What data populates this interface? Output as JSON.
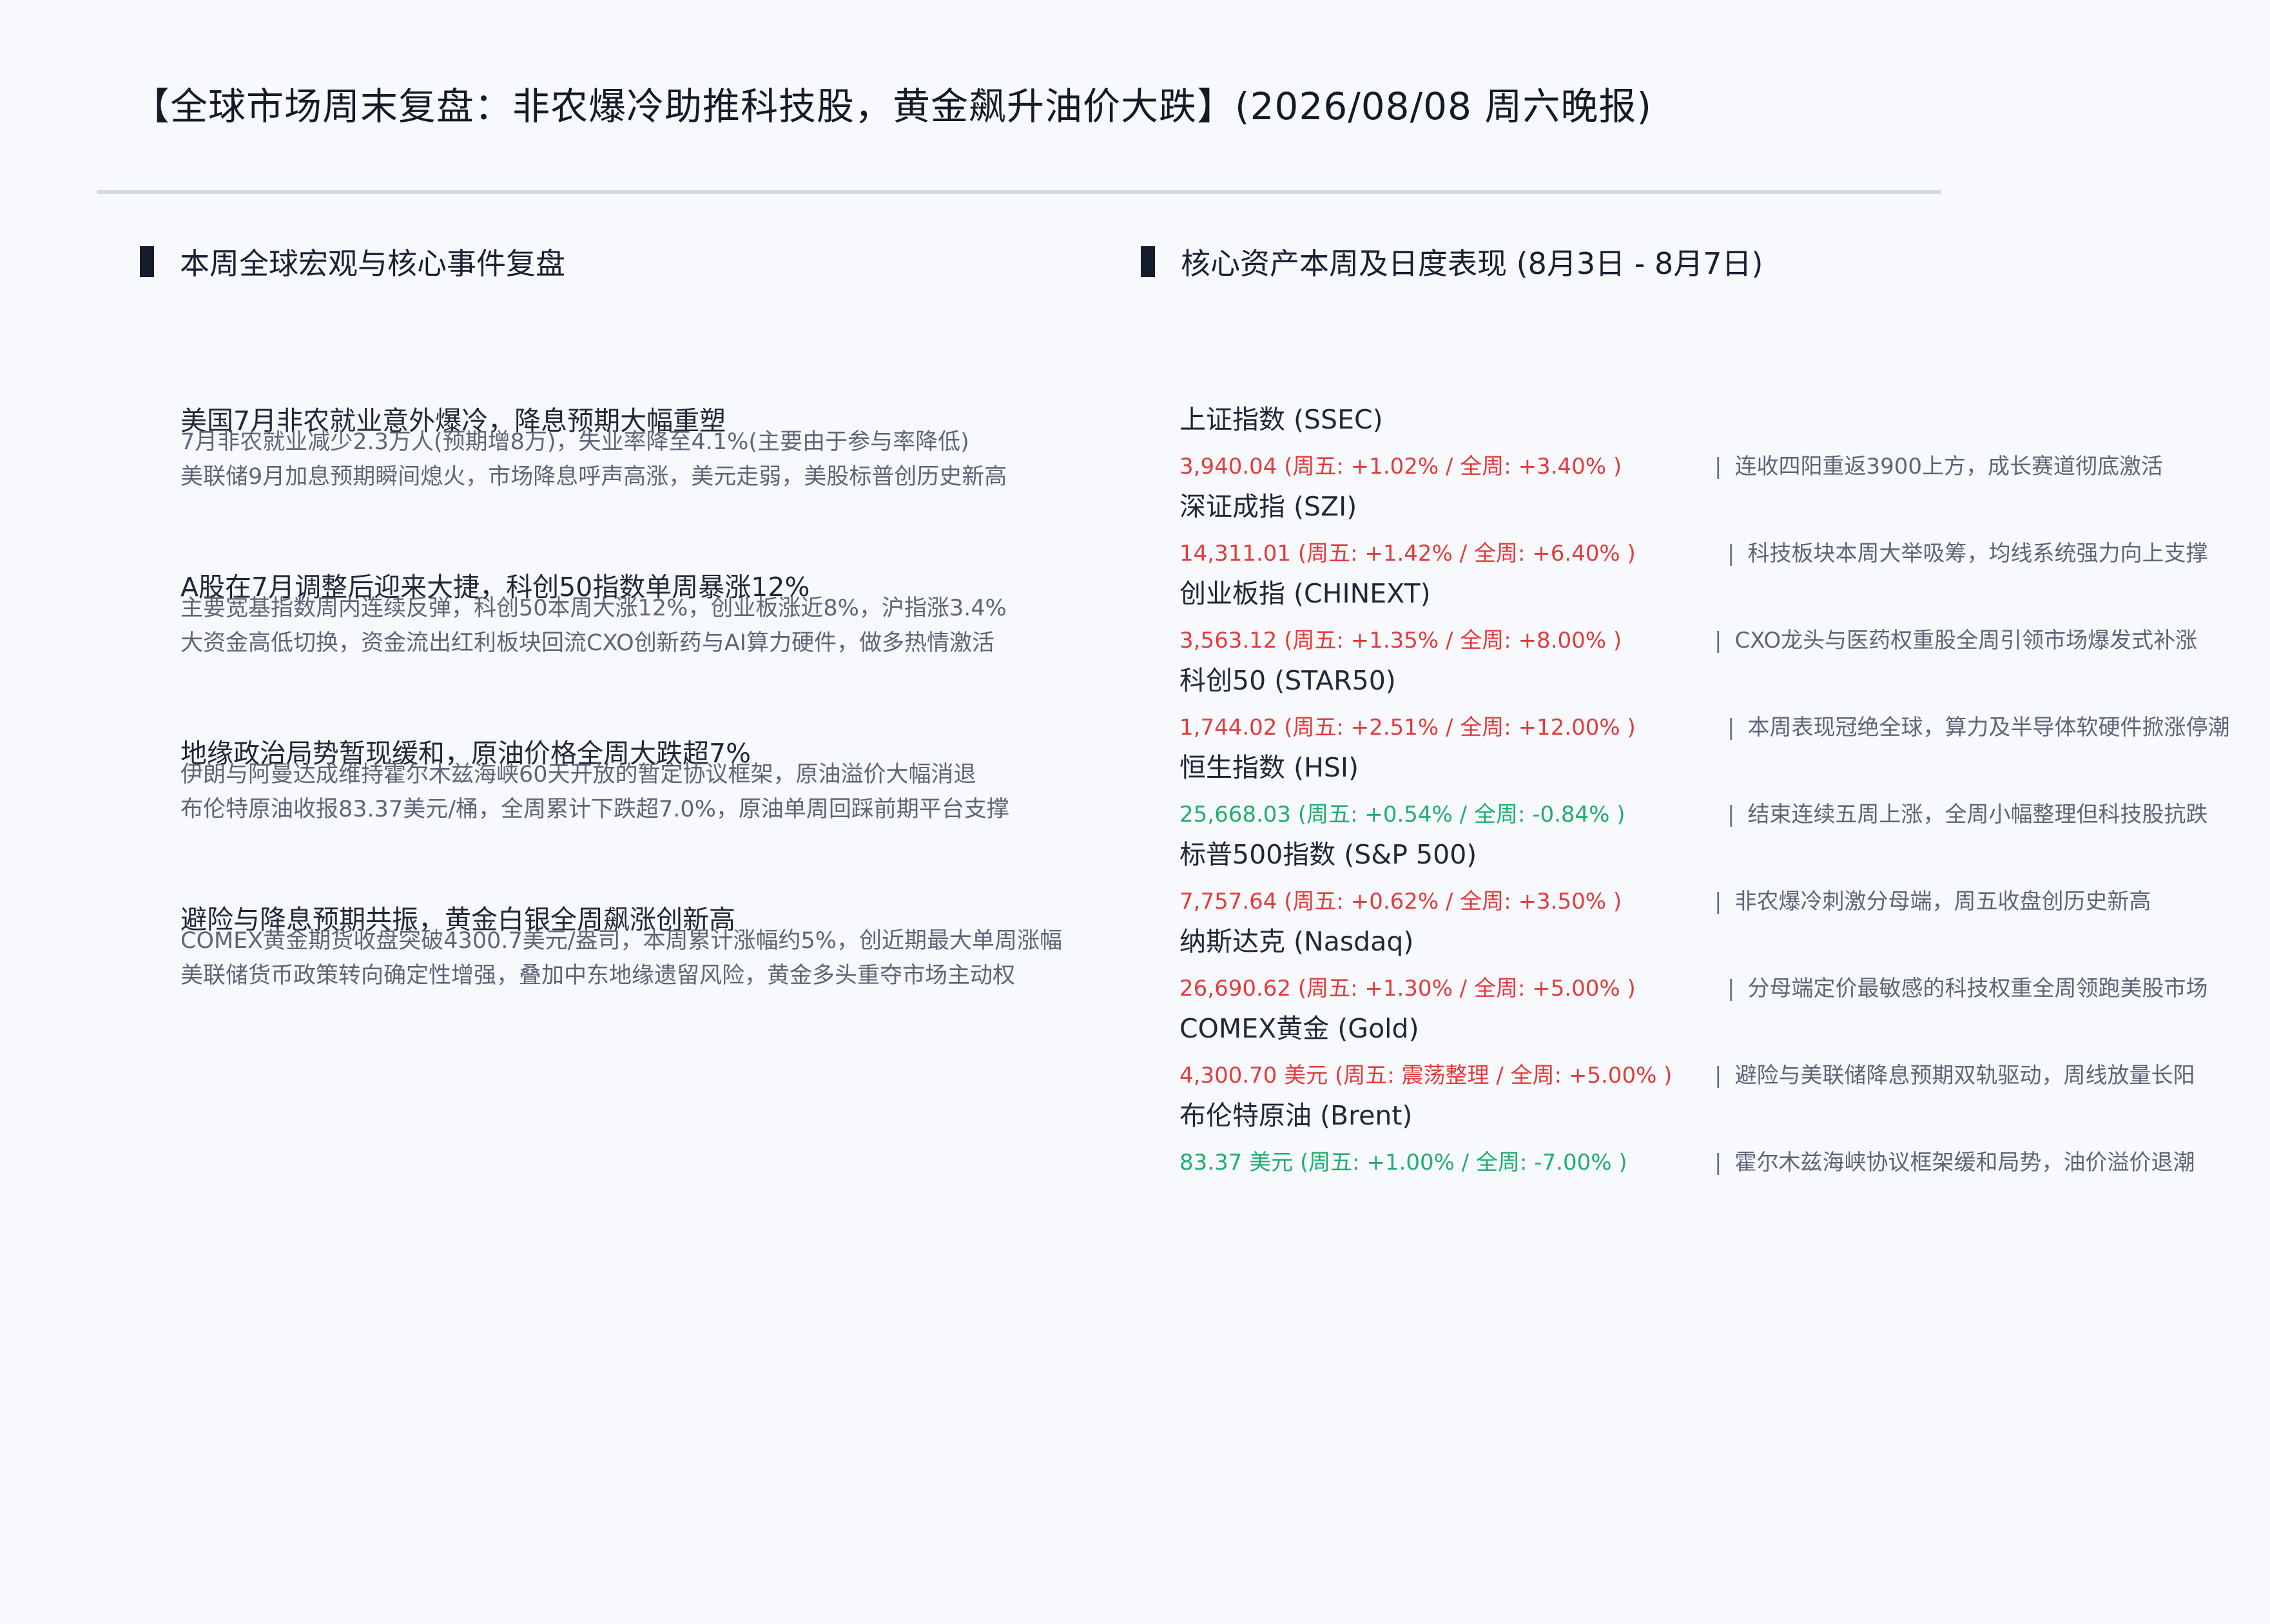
{
  "title": "【全球市场周末复盘：非农爆冷助推科技股，黄金飙升油价大跌】(2026/08/08 周六晚报)",
  "left_section": {
    "heading": "本周全球宏观与核心事件复盘",
    "events": [
      {
        "title": "美国7月非农就业意外爆冷，降息预期大幅重塑",
        "line1": "7月非农就业减少2.3万人(预期增8万)，失业率降至4.1%(主要由于参与率降低)",
        "line2": "美联储9月加息预期瞬间熄火，市场降息呼声高涨，美元走弱，美股标普创历史新高"
      },
      {
        "title": "A股在7月调整后迎来大捷，科创50指数单周暴涨12%",
        "line1": "主要宽基指数周内连续反弹，科创50本周大涨12%，创业板涨近8%，沪指涨3.4%",
        "line2": "大资金高低切换，资金流出红利板块回流CXO创新药与AI算力硬件，做多热情激活"
      },
      {
        "title": "地缘政治局势暂现缓和，原油价格全周大跌超7%",
        "line1": "伊朗与阿曼达成维持霍尔木兹海峡60天开放的暂定协议框架，原油溢价大幅消退",
        "line2": "布伦特原油收报83.37美元/桶，全周累计下跌超7.0%，原油单周回踩前期平台支撑"
      },
      {
        "title": "避险与降息预期共振，黄金白银全周飙涨创新高",
        "line1": "COMEX黄金期货收盘突破4300.7美元/盎司，本周累计涨幅约5%，创近期最大单周涨幅",
        "line2": "美联储货币政策转向确定性增强，叠加中东地缘遗留风险，黄金多头重夺市场主动权"
      }
    ]
  },
  "right_section": {
    "heading": "核心资产本周及日度表现 (8月3日 - 8月7日)",
    "assets": [
      {
        "name": "上证指数 (SSEC)",
        "values": "3,940.04 (周五: +1.02%  / 全周: +3.40% )",
        "note": "连收四阳重返3900上方，成长赛道彻底激活",
        "trend": "up"
      },
      {
        "name": "深证成指 (SZI)",
        "values": "14,311.01 (周五: +1.42%  / 全周: +6.40% )",
        "note": "科技板块本周大举吸筹，均线系统强力向上支撑",
        "trend": "up"
      },
      {
        "name": "创业板指 (CHINEXT)",
        "values": "3,563.12 (周五: +1.35%  / 全周: +8.00% )",
        "note": "CXO龙头与医药权重股全周引领市场爆发式补涨",
        "trend": "up"
      },
      {
        "name": "科创50 (STAR50)",
        "values": "1,744.02 (周五: +2.51%  / 全周: +12.00% )",
        "note": "本周表现冠绝全球，算力及半导体软硬件掀涨停潮",
        "trend": "up"
      },
      {
        "name": "恒生指数 (HSI)",
        "values": "25,668.03 (周五: +0.54%  / 全周: -0.84% )",
        "note": "结束连续五周上涨，全周小幅整理但科技股抗跌",
        "trend": "down"
      },
      {
        "name": "标普500指数 (S&P 500)",
        "values": "7,757.64 (周五: +0.62%  / 全周: +3.50% )",
        "note": "非农爆冷刺激分母端，周五收盘创历史新高",
        "trend": "up"
      },
      {
        "name": "纳斯达克 (Nasdaq)",
        "values": "26,690.62 (周五: +1.30%  / 全周: +5.00% )",
        "note": "分母端定价最敏感的科技权重全周领跑美股市场",
        "trend": "up"
      },
      {
        "name": "COMEX黄金 (Gold)",
        "values": "4,300.70 美元 (周五: 震荡整理 / 全周: +5.00% )",
        "note": "避险与美联储降息预期双轨驱动，周线放量长阳",
        "trend": "up"
      },
      {
        "name": "布伦特原油 (Brent)",
        "values": "83.37 美元 (周五: +1.00%  / 全周: -7.00% )",
        "note": "霍尔木兹海峡协议框架缓和局势，油价溢价退潮",
        "trend": "down"
      }
    ],
    "pipe": "|"
  },
  "colors": {
    "up": "#e23b3b",
    "down": "#1fae6e",
    "text": "#202838",
    "muted": "#5d6677",
    "divider": "#d2dbe8"
  }
}
